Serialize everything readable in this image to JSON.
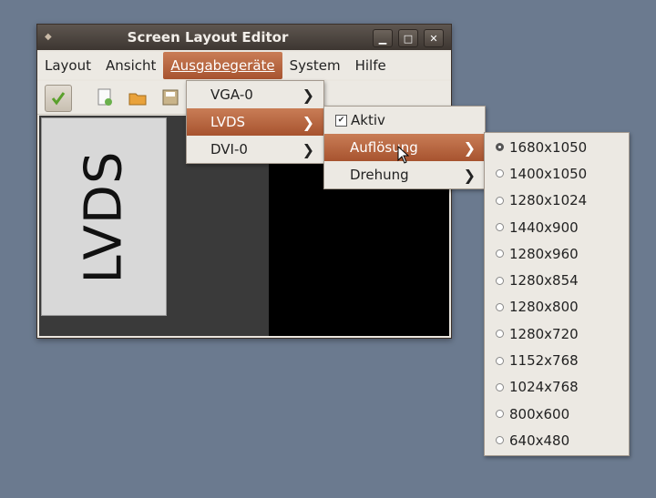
{
  "window": {
    "title": "Screen Layout Editor"
  },
  "menubar": {
    "items": [
      {
        "label": "Layout"
      },
      {
        "label": "Ansicht"
      },
      {
        "label": "Ausgabegeräte"
      },
      {
        "label": "System"
      },
      {
        "label": "Hilfe"
      }
    ]
  },
  "canvas": {
    "output_label": "LVDS"
  },
  "outputs_menu": {
    "items": [
      {
        "label": "VGA-0"
      },
      {
        "label": "LVDS"
      },
      {
        "label": "DVI-0"
      }
    ]
  },
  "lvds_menu": {
    "active_label": "Aktiv",
    "active_checked": true,
    "resolution_label": "Auflösung",
    "rotation_label": "Drehung"
  },
  "resolution_menu": {
    "selected": "1680x1050",
    "options": [
      "1680x1050",
      "1400x1050",
      "1280x1024",
      "1440x900",
      "1280x960",
      "1280x854",
      "1280x800",
      "1280x720",
      "1152x768",
      "1024x768",
      "800x600",
      "640x480"
    ]
  },
  "colors": {
    "highlight": "#b8643d",
    "desktop": "#6b7a8f",
    "titlebar": "#4a423c"
  }
}
